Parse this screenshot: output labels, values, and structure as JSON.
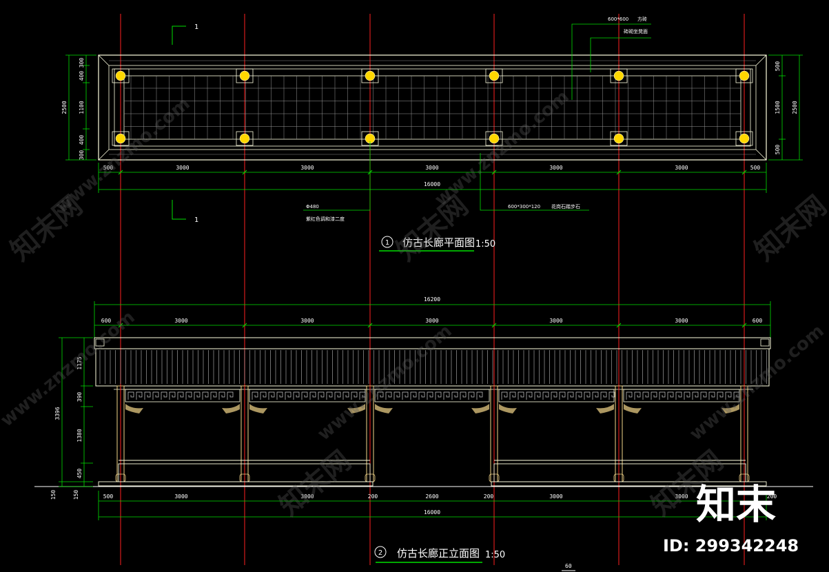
{
  "plan": {
    "title": "仿古长廊平面图",
    "scale": "1:50",
    "index": "1",
    "section_mark": "1",
    "dims_bottom": [
      "500",
      "3000",
      "3000",
      "3000",
      "3000",
      "3000",
      "500"
    ],
    "dim_total": "16000",
    "dims_left": [
      "300",
      "400",
      "1100",
      "400",
      "300"
    ],
    "dim_left_total": "2500",
    "dims_right": [
      "500",
      "1500",
      "500"
    ],
    "dim_right_total": "2500",
    "note_top_1": "600*600",
    "note_top_1b": "方砖",
    "note_top_2": "砖砌坐凳面",
    "note_column_1": "Φ480",
    "note_column_2": "紫红色调和漆二度",
    "note_step_1": "600*300*120",
    "note_step_2": "花岗石踏步石"
  },
  "elevation": {
    "title": "仿古长廊正立面图",
    "scale": "1:50",
    "index": "2",
    "dims_top": [
      "600",
      "3000",
      "3000",
      "3000",
      "3000",
      "3000",
      "600"
    ],
    "dim_top_total": "16200",
    "dims_left": [
      "1175",
      "390",
      "1380",
      "450"
    ],
    "dim_left_total": "3396",
    "dims_left_ground": [
      "150",
      "150"
    ],
    "dims_bottom": [
      "500",
      "3000",
      "3000",
      "200",
      "2600",
      "200",
      "3000",
      "3000",
      "200"
    ],
    "dim_bottom_total": "16000",
    "stray_label": "60"
  },
  "watermark": {
    "brand": "知末",
    "site": "www.znzmo.com",
    "cn": "知末网",
    "id_text": "ID: 299342248"
  },
  "colors": {
    "axis": "#ff2020",
    "dimension": "#00e000",
    "outline": "#ffffe0",
    "wood": "#f5d78a",
    "column": "#ffd700",
    "background": "#000000"
  }
}
